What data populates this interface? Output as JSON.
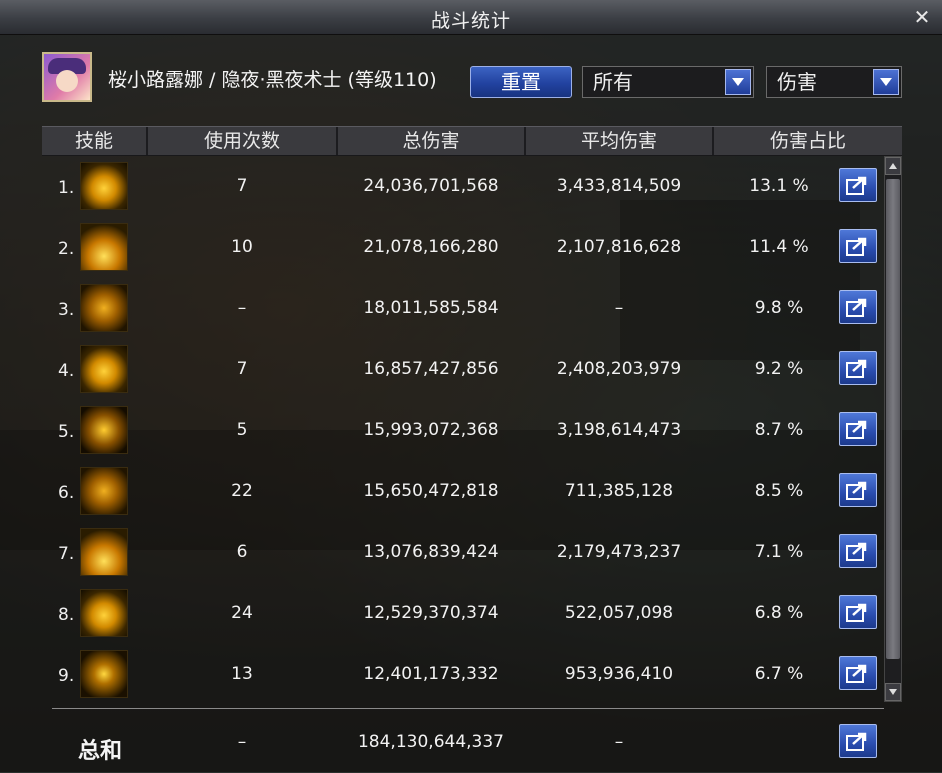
{
  "window": {
    "title": "战斗统计"
  },
  "character": {
    "name": "桜小路露娜 / 隐夜·黑夜术士 (等级110)"
  },
  "controls": {
    "reset_label": "重置",
    "filter_select": "所有",
    "metric_select": "伤害"
  },
  "columns": [
    "技能",
    "使用次数",
    "总伤害",
    "平均伤害",
    "伤害占比"
  ],
  "rows": [
    {
      "index": "1.",
      "uses": "7",
      "total": "24,036,701,568",
      "avg": "3,433,814,509",
      "pct": "13.1 %"
    },
    {
      "index": "2.",
      "uses": "10",
      "total": "21,078,166,280",
      "avg": "2,107,816,628",
      "pct": "11.4 %"
    },
    {
      "index": "3.",
      "uses": "–",
      "total": "18,011,585,584",
      "avg": "–",
      "pct": "9.8 %"
    },
    {
      "index": "4.",
      "uses": "7",
      "total": "16,857,427,856",
      "avg": "2,408,203,979",
      "pct": "9.2 %"
    },
    {
      "index": "5.",
      "uses": "5",
      "total": "15,993,072,368",
      "avg": "3,198,614,473",
      "pct": "8.7 %"
    },
    {
      "index": "6.",
      "uses": "22",
      "total": "15,650,472,818",
      "avg": "711,385,128",
      "pct": "8.5 %"
    },
    {
      "index": "7.",
      "uses": "6",
      "total": "13,076,839,424",
      "avg": "2,179,473,237",
      "pct": "7.1 %"
    },
    {
      "index": "8.",
      "uses": "24",
      "total": "12,529,370,374",
      "avg": "522,057,098",
      "pct": "6.8 %"
    },
    {
      "index": "9.",
      "uses": "13",
      "total": "12,401,173,332",
      "avg": "953,936,410",
      "pct": "6.7 %"
    }
  ],
  "total_row": {
    "label": "总和",
    "uses": "–",
    "total": "184,130,644,337",
    "avg": "–"
  },
  "icons": {
    "close": "close-icon",
    "share": "share-icon"
  },
  "colors": {
    "accent_blue": "#2a4cae",
    "skill_gold": "#ffd23a"
  }
}
